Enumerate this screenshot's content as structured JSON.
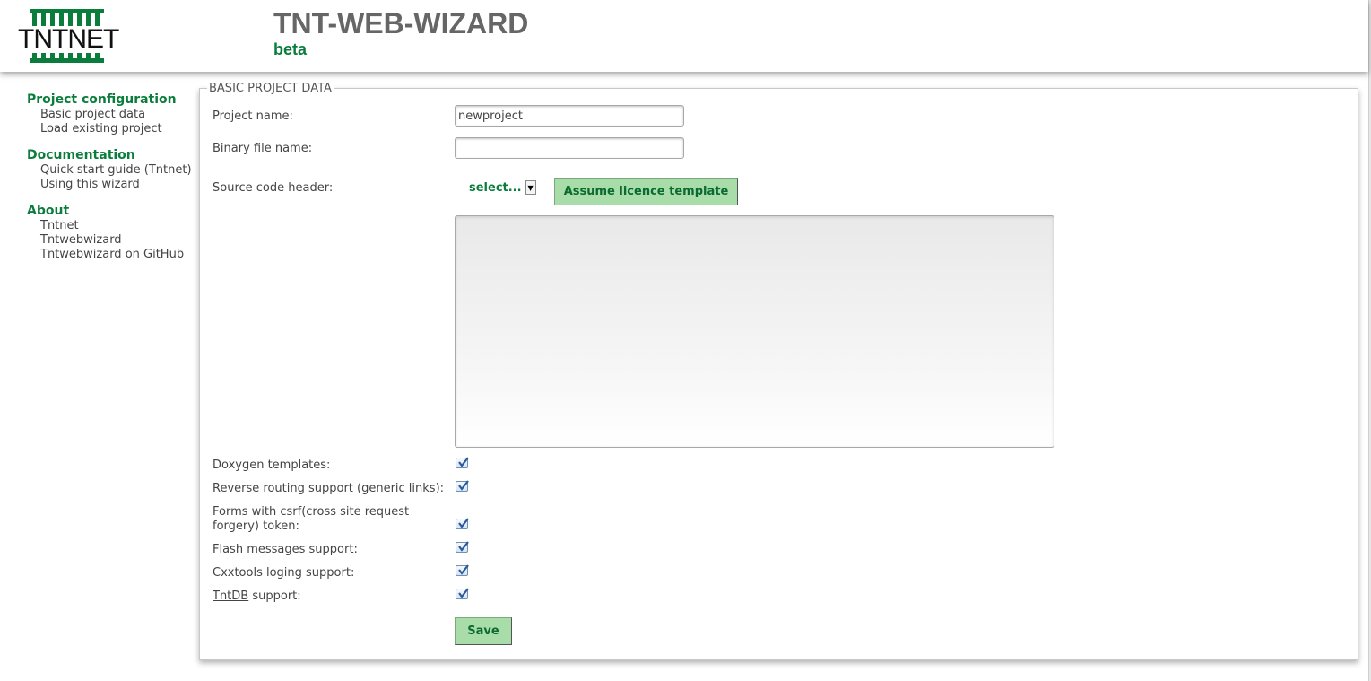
{
  "header": {
    "logo_text": "TNTNET",
    "title": "TNT-WEB-WIZARD",
    "subtitle": "beta"
  },
  "sidebar": {
    "groups": [
      {
        "heading": "Project configuration",
        "items": [
          "Basic project data",
          "Load existing project"
        ]
      },
      {
        "heading": "Documentation",
        "items": [
          "Quick start guide (Tntnet)",
          "Using this wizard"
        ]
      },
      {
        "heading": "About",
        "items": [
          "Tntnet",
          "Tntwebwizard",
          "Tntwebwizard on GitHub"
        ]
      }
    ]
  },
  "form": {
    "legend": "BASIC PROJECT DATA",
    "project_name_label": "Project name:",
    "project_name_value": "newproject",
    "binary_name_label": "Binary file name:",
    "binary_name_value": "",
    "source_header_label": "Source code header:",
    "source_header_select": "select...",
    "assume_button": "Assume licence template",
    "source_header_text": "",
    "options": [
      {
        "label": "Doxygen templates:",
        "checked": true
      },
      {
        "label": "Reverse routing support (generic links):",
        "checked": true
      },
      {
        "label": "Forms with csrf(cross site request forgery) token:",
        "checked": true
      },
      {
        "label": "Flash messages support:",
        "checked": true
      },
      {
        "label": "Cxxtools loging support:",
        "checked": true
      },
      {
        "label_link": "TntDB",
        "label_rest": " support:",
        "checked": true
      }
    ],
    "save_button": "Save"
  },
  "colors": {
    "brand_green": "#0a7d3c",
    "button_bg": "#a8dca8",
    "title_gray": "#666666"
  }
}
